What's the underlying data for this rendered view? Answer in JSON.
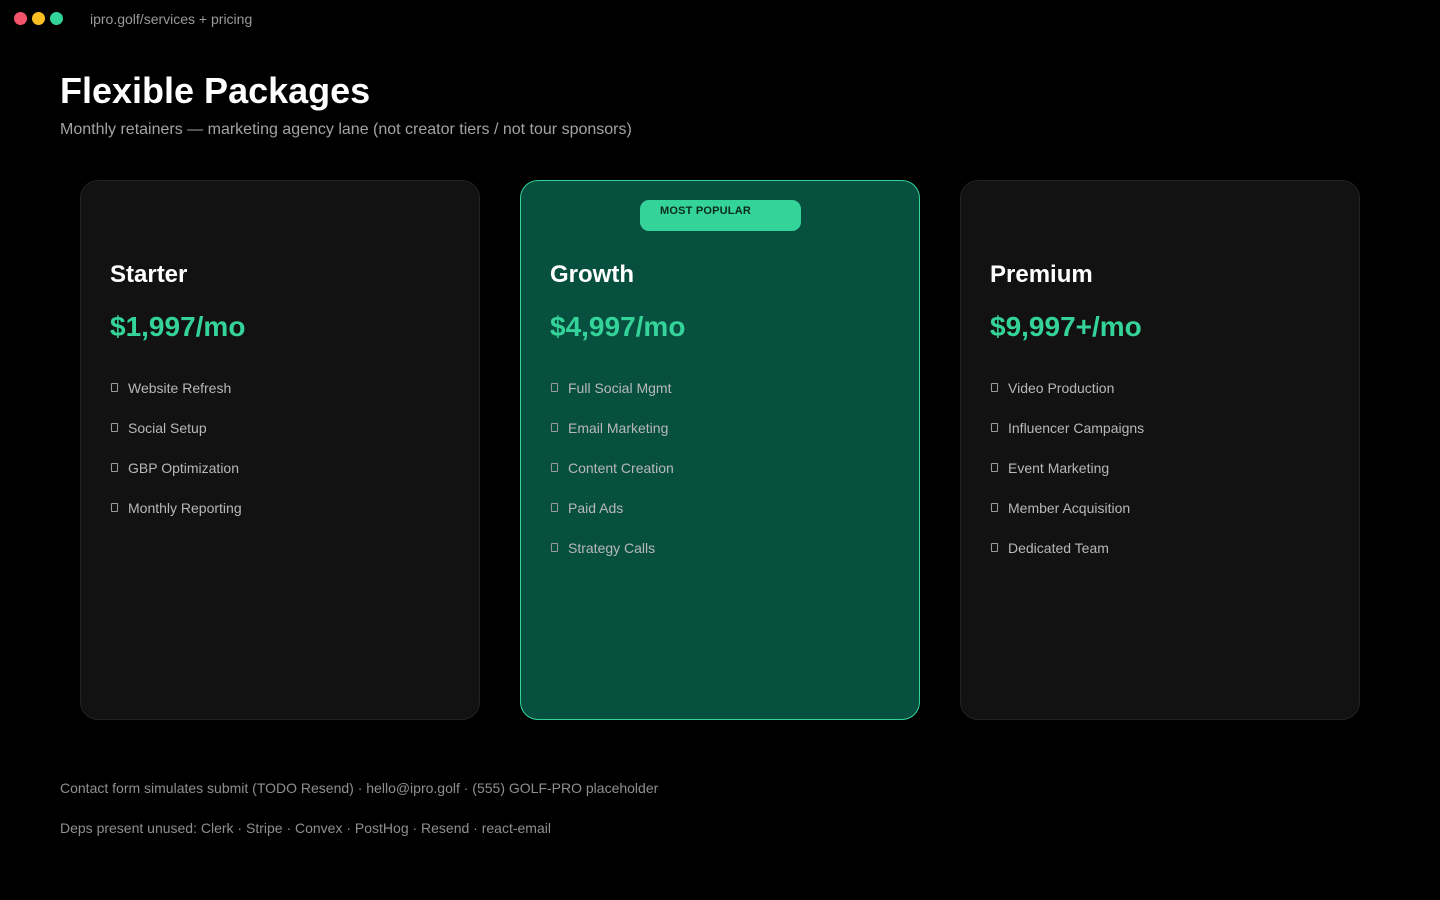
{
  "window": {
    "url": "ipro.golf/services + pricing"
  },
  "header": {
    "title": "Flexible Packages",
    "subtitle": "Monthly retainers — marketing agency lane (not creator tiers / not tour sponsors)"
  },
  "plans": [
    {
      "name": "Starter",
      "price": "$1,997/mo",
      "features": [
        "Website Refresh",
        "Social Setup",
        "GBP Optimization",
        "Monthly Reporting"
      ]
    },
    {
      "name": "Growth",
      "price": "$4,997/mo",
      "badge": "MOST POPULAR",
      "features": [
        "Full Social Mgmt",
        "Email Marketing",
        "Content Creation",
        "Paid Ads",
        "Strategy Calls"
      ]
    },
    {
      "name": "Premium",
      "price": "$9,997+/mo",
      "features": [
        "Video Production",
        "Influencer Campaigns",
        "Event Marketing",
        "Member Acquisition",
        "Dedicated Team"
      ]
    }
  ],
  "footer": {
    "contact": "Contact form simulates submit (TODO Resend) · hello@ipro.golf · (555) GOLF-PRO placeholder",
    "deps": "Deps present unused: Clerk · Stripe · Convex · PostHog · Resend · react-email"
  },
  "colors": {
    "accent": "#34d399",
    "highlight_card": "#07503f",
    "card": "#121212",
    "background": "#000000"
  },
  "icons": {
    "feature_marker": "check-box-icon"
  }
}
